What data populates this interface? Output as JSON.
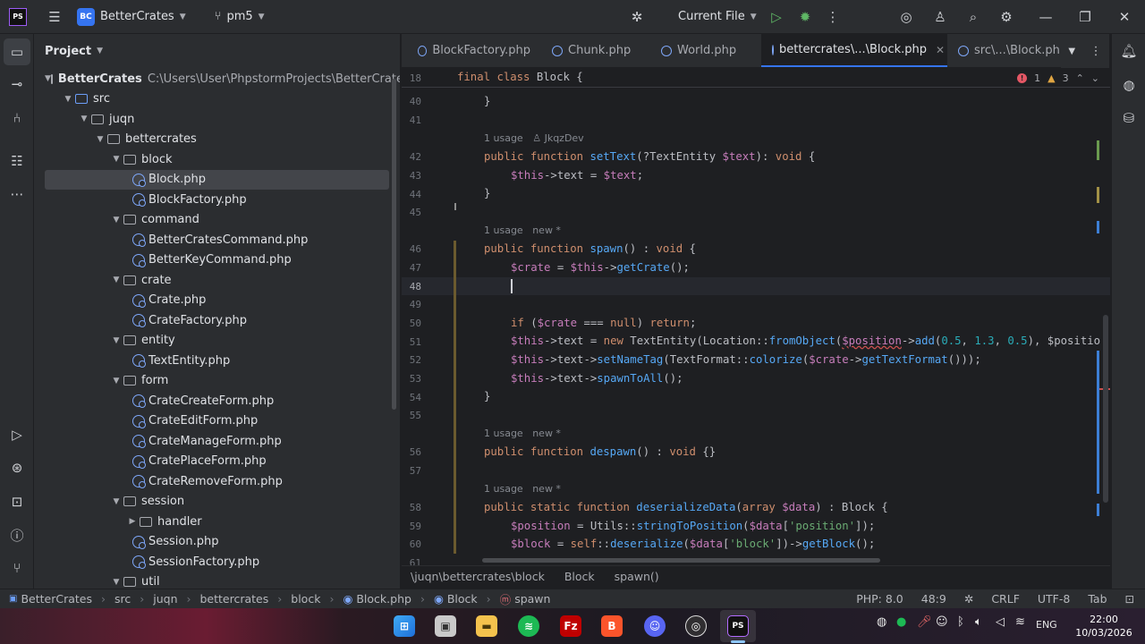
{
  "titlebar": {
    "project_badge": "BC",
    "project_name": "BetterCrates",
    "vcs_branch": "pm5",
    "run_config": "Current File"
  },
  "project_panel": {
    "title": "Project",
    "root_name": "BetterCrates",
    "root_path": "C:\\Users\\User\\PhpstormProjects\\BetterCrates",
    "items": [
      {
        "label": "src",
        "type": "folder-src",
        "depth": 1,
        "expanded": true
      },
      {
        "label": "juqn",
        "type": "folder",
        "depth": 2,
        "expanded": true
      },
      {
        "label": "bettercrates",
        "type": "folder",
        "depth": 3,
        "expanded": true
      },
      {
        "label": "block",
        "type": "folder",
        "depth": 4,
        "expanded": true
      },
      {
        "label": "Block.php",
        "type": "php",
        "depth": 5,
        "selected": true
      },
      {
        "label": "BlockFactory.php",
        "type": "php",
        "depth": 5
      },
      {
        "label": "command",
        "type": "folder",
        "depth": 4,
        "expanded": true
      },
      {
        "label": "BetterCratesCommand.php",
        "type": "php",
        "depth": 5
      },
      {
        "label": "BetterKeyCommand.php",
        "type": "php",
        "depth": 5
      },
      {
        "label": "crate",
        "type": "folder",
        "depth": 4,
        "expanded": true
      },
      {
        "label": "Crate.php",
        "type": "php",
        "depth": 5
      },
      {
        "label": "CrateFactory.php",
        "type": "php",
        "depth": 5
      },
      {
        "label": "entity",
        "type": "folder",
        "depth": 4,
        "expanded": true
      },
      {
        "label": "TextEntity.php",
        "type": "php",
        "depth": 5
      },
      {
        "label": "form",
        "type": "folder",
        "depth": 4,
        "expanded": true
      },
      {
        "label": "CrateCreateForm.php",
        "type": "php",
        "depth": 5
      },
      {
        "label": "CrateEditForm.php",
        "type": "php",
        "depth": 5
      },
      {
        "label": "CrateManageForm.php",
        "type": "php",
        "depth": 5
      },
      {
        "label": "CratePlaceForm.php",
        "type": "php",
        "depth": 5
      },
      {
        "label": "CrateRemoveForm.php",
        "type": "php",
        "depth": 5
      },
      {
        "label": "session",
        "type": "folder",
        "depth": 4,
        "expanded": true
      },
      {
        "label": "handler",
        "type": "folder",
        "depth": 5,
        "expanded": false
      },
      {
        "label": "Session.php",
        "type": "php",
        "depth": 5
      },
      {
        "label": "SessionFactory.php",
        "type": "php",
        "depth": 5
      },
      {
        "label": "util",
        "type": "folder",
        "depth": 4,
        "expanded": true
      }
    ]
  },
  "tabs": [
    {
      "label": "BlockFactory.php",
      "active": false
    },
    {
      "label": "Chunk.php",
      "active": false
    },
    {
      "label": "World.php",
      "active": false
    },
    {
      "label": "bettercrates\\...\\Block.php",
      "active": true
    },
    {
      "label": "src\\...\\Block.php",
      "active": false
    }
  ],
  "inspections": {
    "errors": "1",
    "warnings": "3"
  },
  "editor": {
    "line_numbers": [
      "18",
      "40",
      "41",
      "42",
      "43",
      "44",
      "45",
      "46",
      "47",
      "48",
      "49",
      "50",
      "51",
      "52",
      "53",
      "54",
      "55",
      "56",
      "57",
      "58",
      "59",
      "60",
      "61"
    ],
    "hints": {
      "h42_usage": "1 usage",
      "h42_author": "JkqzDev",
      "h46_usage": "1 usage",
      "h46_new": "new *",
      "h56_usage": "1 usage",
      "h56_new": "new *",
      "h58_usage": "1 usage",
      "h58_new": "new *"
    },
    "tokens": {
      "final": "final",
      "class": "class",
      "block_name": "Block",
      "brace_open": " {",
      "close_brace": "}",
      "public": "public",
      "function": "function",
      "static": "static",
      "setText": "setText",
      "setText_params_a": "(?TextEntity ",
      "text_var": "$text",
      "setText_params_b": "): ",
      "void": "void",
      "brace_tail": " {",
      "this": "$this",
      "arrow_text": "->text = ",
      "semicolon": ";",
      "spawn": "spawn",
      "spawn_sig": "() : ",
      "crate_var": "$crate",
      "assign": " = ",
      "arrow": "->",
      "getCrate": "getCrate",
      "call_end": "();",
      "if": "if",
      "if_open": " (",
      "strict_eq": " === ",
      "null": "null",
      "if_close": ") ",
      "return": "return",
      "text_prop": "text",
      "new": "new",
      "TextEntity": " TextEntity(",
      "Location": "Location::",
      "fromObject": "fromObject",
      "position_var": "$position",
      "add": "add",
      "n05": "0.5",
      "n13": "1.3",
      "comma": ", ",
      "line51_tail": "), $positio",
      "setNameTag": "setNameTag",
      "TextFormat": "(TextFormat::",
      "colorize": "colorize",
      "getTextFormat": "getTextFormat",
      "line52_tail": "()));",
      "spawnToAll": "spawnToAll",
      "despawn": "despawn",
      "despawn_sig": "() : ",
      "empty_body": " {}",
      "deserializeData": "deserializeData",
      "array": "array",
      "data_var": "$data",
      "deser_sig_a": "(",
      "deser_sig_b": ") : Block {",
      "Utils": "Utils::",
      "stringToPosition": "stringToPosition",
      "str_position": "'position'",
      "idx_close": "]);",
      "block_var": "$block",
      "self": "self",
      "dcolon": "::",
      "deserialize": "deserialize",
      "str_block": "'block'",
      "getBlock": "getBlock",
      "paren_open": "(",
      "bracket_open": "[",
      "idx_close2": "])->"
    }
  },
  "editor_breadcrumb": [
    "\\juqn\\bettercrates\\block",
    "Block",
    "spawn()"
  ],
  "statusbar": {
    "crumbs": [
      "BetterCrates",
      "src",
      "juqn",
      "bettercrates",
      "block",
      "Block.php",
      "Block",
      "spawn"
    ],
    "php_version": "PHP: 8.0",
    "cursor": "48:9",
    "line_sep": "CRLF",
    "encoding": "UTF-8",
    "indent": "Tab"
  },
  "taskbar": {
    "lang": "ENG",
    "time": "22:00",
    "date": "10/03/2026"
  }
}
